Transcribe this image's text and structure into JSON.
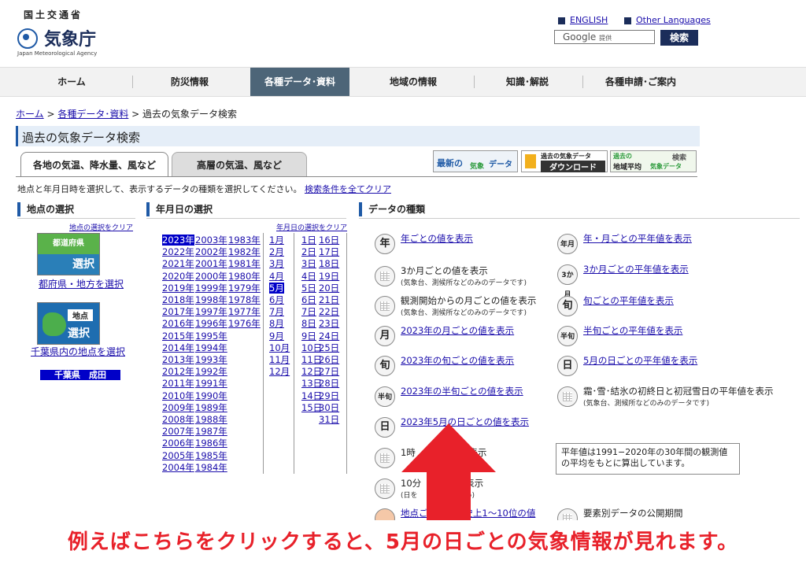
{
  "header": {
    "ministry": "国土交通省",
    "agency": "気象庁",
    "agency_en": "Japan Meteorological Agency",
    "link_english": "ENGLISH",
    "link_other_languages": "Other Languages",
    "search_brand": "Google",
    "search_brand_suffix": "提供",
    "search_button": "検索"
  },
  "nav": [
    "ホーム",
    "防災情報",
    "各種データ･資料",
    "地域の情報",
    "知識･解説",
    "各種申請･ご案内"
  ],
  "breadcrumb": {
    "home": "ホーム",
    "data": "各種データ･資料",
    "current": "過去の気象データ検索"
  },
  "page_title": "過去の気象データ検索",
  "tabs": [
    "各地の気温、降水量、風など",
    "高層の気温、風など"
  ],
  "banners": {
    "latest": {
      "a": "最新の",
      "b": "気象",
      "c": "データ"
    },
    "download": {
      "a": "過去の気象データ",
      "b": "ダウンロード"
    },
    "regional": {
      "a": "過去の",
      "b": "地域平均",
      "c": "気象データ",
      "d": "検索"
    }
  },
  "instruction": "地点と年月日時を選択して、表示するデータの種類を選択してください。",
  "clear_all": "検索条件を全てクリア",
  "sections": {
    "location": "地点の選択",
    "date": "年月日の選択",
    "data_type": "データの種類"
  },
  "location": {
    "clear": "地点の選択をクリア",
    "pref_label": "都道府県",
    "select": "選択",
    "pref_link": "都府県・地方を選択",
    "point_label": "地点",
    "point_link": "千葉県内の地点を選択",
    "station": "千葉県　成田"
  },
  "date": {
    "clear": "年月日の選択をクリア",
    "years_col1": [
      "2023年",
      "2022年",
      "2021年",
      "2020年",
      "2019年",
      "2018年",
      "2017年",
      "2016年",
      "2015年",
      "2014年",
      "2013年",
      "2012年",
      "2011年",
      "2010年",
      "2009年",
      "2008年",
      "2007年",
      "2006年",
      "2005年",
      "2004年"
    ],
    "years_col2": [
      "2003年",
      "2002年",
      "2001年",
      "2000年",
      "1999年",
      "1998年",
      "1997年",
      "1996年",
      "1995年",
      "1994年",
      "1993年",
      "1992年",
      "1991年",
      "1990年",
      "1989年",
      "1988年",
      "1987年",
      "1986年",
      "1985年",
      "1984年"
    ],
    "years_col3": [
      "1983年",
      "1982年",
      "1981年",
      "1980年",
      "1979年",
      "1978年",
      "1977年",
      "1976年"
    ],
    "months": [
      "1月",
      "2月",
      "3月",
      "4月",
      "5月",
      "6月",
      "7月",
      "8月",
      "9月",
      "10月",
      "11月",
      "12月"
    ],
    "days_col1": [
      "1日",
      "2日",
      "3日",
      "4日",
      "5日",
      "6日",
      "7日",
      "8日",
      "9日",
      "10日",
      "11日",
      "12日",
      "13日",
      "14日",
      "15日"
    ],
    "days_col2": [
      "16日",
      "17日",
      "18日",
      "19日",
      "20日",
      "21日",
      "22日",
      "23日",
      "24日",
      "25日",
      "26日",
      "27日",
      "28日",
      "29日",
      "30日",
      "31日"
    ]
  },
  "data_left": [
    {
      "icon": "年",
      "label": "年ごとの値を表示",
      "link": true
    },
    {
      "icon": "grid",
      "label": "3か月ごとの値を表示",
      "note": "(気象台、測候所などのみのデータです)",
      "link": false
    },
    {
      "icon": "grid",
      "label": "観測開始からの月ごとの値を表示",
      "note": "(気象台、測候所などのみのデータです)",
      "link": false
    },
    {
      "icon": "月",
      "label": "2023年の月ごとの値を表示",
      "link": true
    },
    {
      "icon": "旬",
      "label": "2023年の旬ごとの値を表示",
      "link": true
    },
    {
      "icon": "半旬",
      "label": "2023年の半旬ごとの値を表示",
      "link": true
    },
    {
      "icon": "日",
      "label": "2023年5月の日ごとの値を表示",
      "link": true
    },
    {
      "icon": "grid",
      "label": "1時",
      "label2": "を表示",
      "link": false
    },
    {
      "icon": "grid",
      "label": "10分",
      "label2": "表示",
      "note": "(日を",
      "note2": "い)",
      "link": false
    },
    {
      "icon": "cone",
      "label": "地点ごとの観測史上1〜10位の値",
      "link": true
    }
  ],
  "data_right": [
    {
      "icon": "年月",
      "label": "年・月ごとの平年値を表示",
      "link": true
    },
    {
      "icon": "3か月",
      "label": "3か月ごとの平年値を表示",
      "link": true
    },
    {
      "icon": "旬",
      "label": "旬ごとの平年値を表示",
      "link": true
    },
    {
      "icon": "半旬",
      "label": "半旬ごとの平年値を表示",
      "link": true
    },
    {
      "icon": "日",
      "label": "5月の日ごとの平年値を表示",
      "link": true
    },
    {
      "icon": "grid",
      "label": "霜･雪･結氷の初終日と初冠雪日の平年値を表示",
      "note": "(気象台、測候所などのみのデータです)",
      "link": false
    },
    {
      "icon": "grid",
      "label": "要素別データの公開期間",
      "link": false
    }
  ],
  "note_box": "平年値は1991−2020年の30年間の観測値の平均をもとに算出しています。",
  "annotation": "例えばこちらをクリックすると、5月の日ごとの気象情報が見れます。",
  "colors": {
    "accent_blue": "#1f5aa6",
    "nav_active": "#4d6578",
    "annotation_red": "#e8212a",
    "selection_blue": "#0000c8"
  }
}
